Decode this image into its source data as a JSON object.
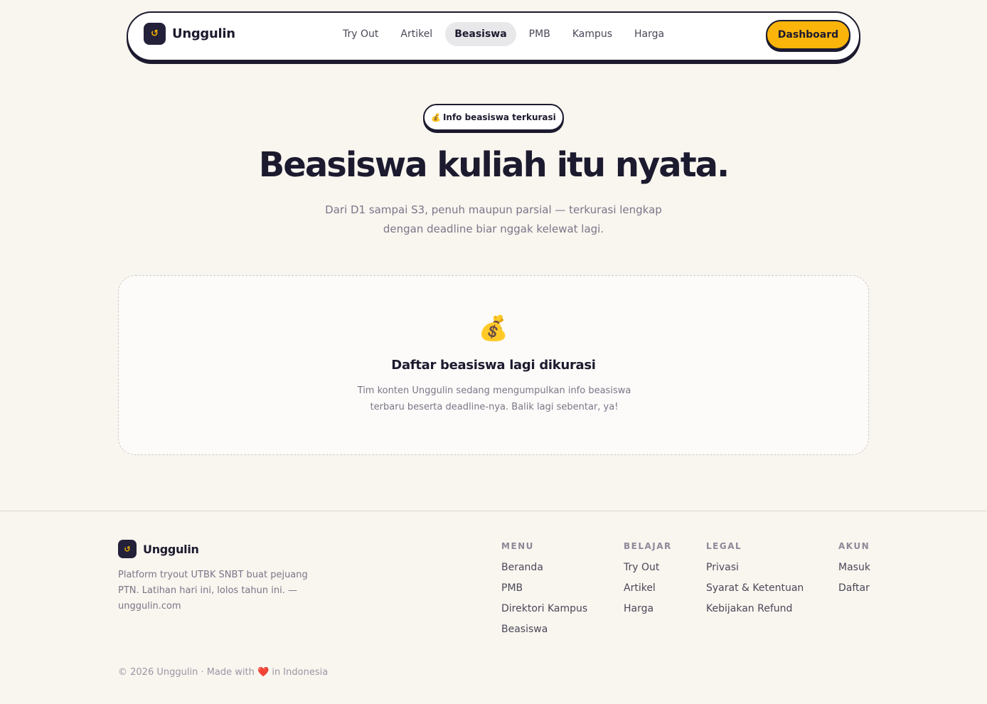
{
  "nav": {
    "brand": "Unggulin",
    "logo_glyph": "↺",
    "links": [
      {
        "label": "Try Out",
        "active": false
      },
      {
        "label": "Artikel",
        "active": false
      },
      {
        "label": "Beasiswa",
        "active": true
      },
      {
        "label": "PMB",
        "active": false
      },
      {
        "label": "Kampus",
        "active": false
      },
      {
        "label": "Harga",
        "active": false
      }
    ],
    "cta": "Dashboard"
  },
  "hero": {
    "pill_emoji": "💰",
    "pill_label": "Info beasiswa terkurasi",
    "title": "Beasiswa kuliah itu nyata.",
    "subtitle_line1": "Dari D1 sampai S3, penuh maupun parsial — terkurasi lengkap",
    "subtitle_line2": "dengan deadline biar nggak kelewat lagi."
  },
  "empty_state": {
    "icon": "💰",
    "title": "Daftar beasiswa lagi dikurasi",
    "text_line1": "Tim konten Unggulin sedang mengumpulkan info beasiswa",
    "text_line2": "terbaru beserta deadline-nya. Balik lagi sebentar, ya!"
  },
  "footer": {
    "brand": "Unggulin",
    "desc_line1": "Platform tryout UTBK SNBT buat pejuang",
    "desc_line2": "PTN. Latihan hari ini, lolos tahun ini. —",
    "desc_line3": "unggulin.com",
    "columns": [
      {
        "heading": "MENU",
        "links": [
          "Beranda",
          "PMB",
          "Direktori Kampus",
          "Beasiswa"
        ]
      },
      {
        "heading": "BELAJAR",
        "links": [
          "Try Out",
          "Artikel",
          "Harga"
        ]
      },
      {
        "heading": "LEGAL",
        "links": [
          "Privasi",
          "Syarat & Ketentuan",
          "Kebijakan Refund"
        ]
      },
      {
        "heading": "AKUN",
        "links": [
          "Masuk",
          "Daftar"
        ]
      }
    ],
    "copy_prefix": "© 2026 Unggulin · Made with",
    "copy_heart": "❤️",
    "copy_suffix": "in Indonesia"
  },
  "colors": {
    "background": "#f9f5ef",
    "ink": "#1c1a2e",
    "accent": "#fbb40a"
  }
}
